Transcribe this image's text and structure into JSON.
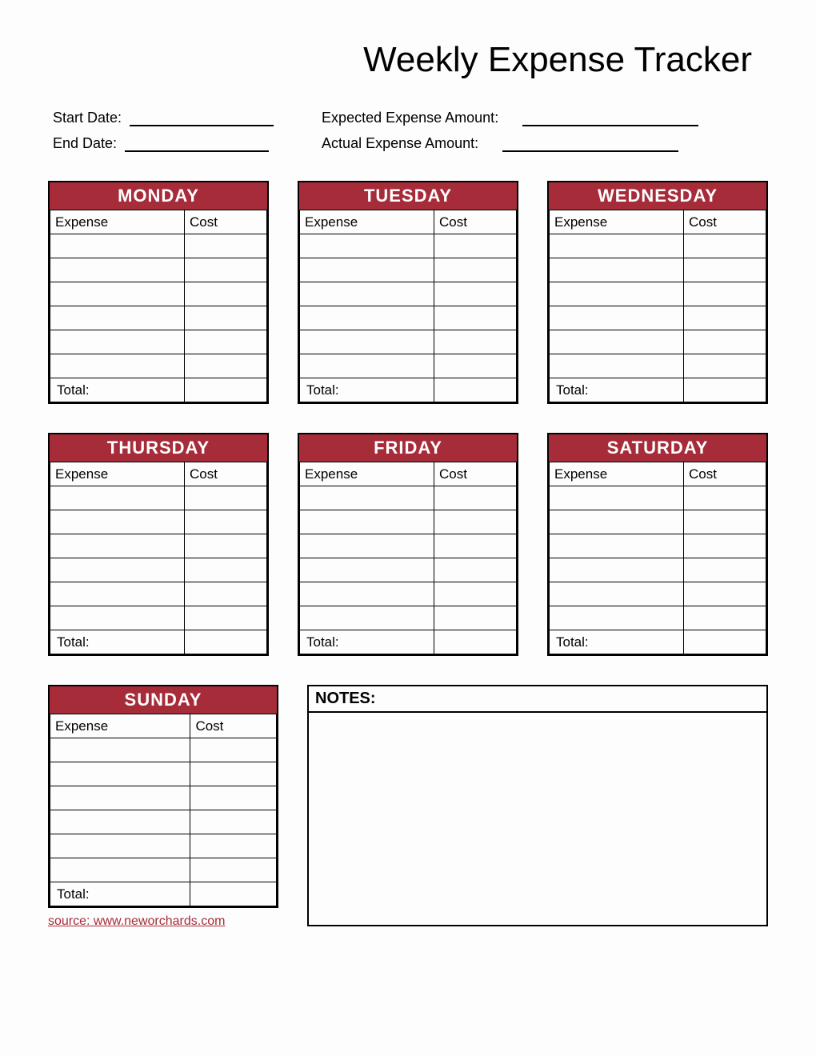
{
  "title": "Weekly Expense Tracker",
  "meta": {
    "start_date_label": "Start Date:",
    "end_date_label": "End Date:",
    "expected_label": "Expected Expense Amount:",
    "actual_label": "Actual Expense Amount:",
    "start_date_value": "",
    "end_date_value": "",
    "expected_value": "",
    "actual_value": ""
  },
  "columns": {
    "expense": "Expense",
    "cost": "Cost"
  },
  "total_label": "Total:",
  "days": [
    {
      "name": "MONDAY",
      "rows": [
        "",
        "",
        "",
        "",
        "",
        ""
      ],
      "total": ""
    },
    {
      "name": "TUESDAY",
      "rows": [
        "",
        "",
        "",
        "",
        "",
        ""
      ],
      "total": ""
    },
    {
      "name": "WEDNESDAY",
      "rows": [
        "",
        "",
        "",
        "",
        "",
        ""
      ],
      "total": ""
    },
    {
      "name": "THURSDAY",
      "rows": [
        "",
        "",
        "",
        "",
        "",
        ""
      ],
      "total": ""
    },
    {
      "name": "FRIDAY",
      "rows": [
        "",
        "",
        "",
        "",
        "",
        ""
      ],
      "total": ""
    },
    {
      "name": "SATURDAY",
      "rows": [
        "",
        "",
        "",
        "",
        "",
        ""
      ],
      "total": ""
    },
    {
      "name": "SUNDAY",
      "rows": [
        "",
        "",
        "",
        "",
        "",
        ""
      ],
      "total": ""
    }
  ],
  "notes_label": "NOTES:",
  "notes_value": "",
  "source_label": "source: www.neworchards.com",
  "colors": {
    "accent": "#a72c3a"
  }
}
